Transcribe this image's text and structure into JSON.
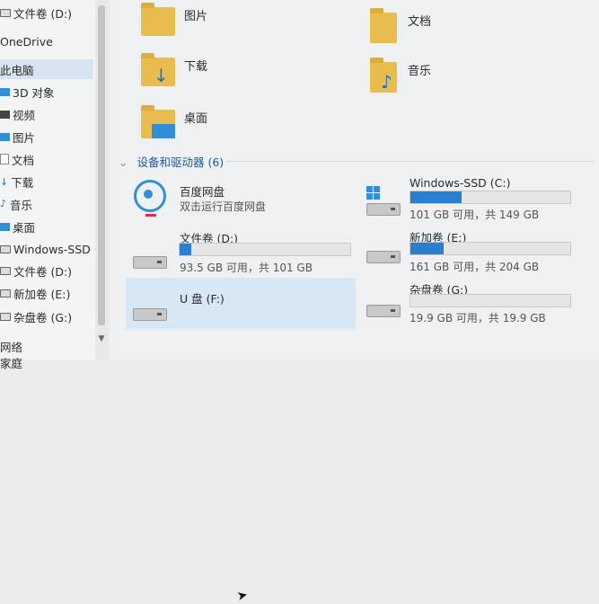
{
  "sidebar": {
    "items": [
      {
        "label": "文件卷 (D:)",
        "icon": "drive-icon"
      },
      {
        "label": "OneDrive",
        "icon": "cloud-icon"
      },
      {
        "label": "此电脑",
        "icon": "pc-icon",
        "selected": true
      },
      {
        "label": "3D 对象",
        "icon": "3d-objects-icon"
      },
      {
        "label": "视频",
        "icon": "video-icon"
      },
      {
        "label": "图片",
        "icon": "picture-icon"
      },
      {
        "label": "文档",
        "icon": "document-icon"
      },
      {
        "label": "下载",
        "icon": "download-icon"
      },
      {
        "label": "音乐",
        "icon": "music-icon"
      },
      {
        "label": "桌面",
        "icon": "desktop-icon"
      },
      {
        "label": "Windows-SSD (",
        "icon": "drive-icon"
      },
      {
        "label": "文件卷 (D:)",
        "icon": "drive-icon"
      },
      {
        "label": "新加卷 (E:)",
        "icon": "drive-icon"
      },
      {
        "label": "杂盘卷 (G:)",
        "icon": "drive-icon"
      },
      {
        "label": "网络",
        "icon": "network-icon"
      },
      {
        "label": "家庭",
        "icon": "homegroup-icon"
      }
    ]
  },
  "folders": [
    {
      "label": "图片",
      "icon": "picture-folder-icon"
    },
    {
      "label": "文档",
      "icon": "document-folder-icon"
    },
    {
      "label": "下载",
      "icon": "download-folder-icon"
    },
    {
      "label": "音乐",
      "icon": "music-folder-icon"
    },
    {
      "label": "桌面",
      "icon": "desktop-folder-icon"
    }
  ],
  "devices_header": "设备和驱动器 (6)",
  "devices": {
    "baidu": {
      "name": "百度网盘",
      "subtitle": "双击运行百度网盘"
    },
    "c": {
      "name": "Windows-SSD (C:)",
      "size": "101 GB 可用，共 149 GB",
      "used_fraction": 0.32
    },
    "d": {
      "name": "文件卷 (D:)",
      "size": "93.5 GB 可用，共 101 GB",
      "used_fraction": 0.07
    },
    "e": {
      "name": "新加卷 (E:)",
      "size": "161 GB 可用，共 204 GB",
      "used_fraction": 0.21
    },
    "f": {
      "name": "U 盘 (F:)"
    },
    "g": {
      "name": "杂盘卷 (G:)",
      "size": "19.9 GB 可用，共 19.9 GB",
      "used_fraction": 0.0
    }
  },
  "colors": {
    "accent": "#2a7fd0",
    "selection": "#d7e7f3",
    "header_text": "#1e5a9c"
  }
}
